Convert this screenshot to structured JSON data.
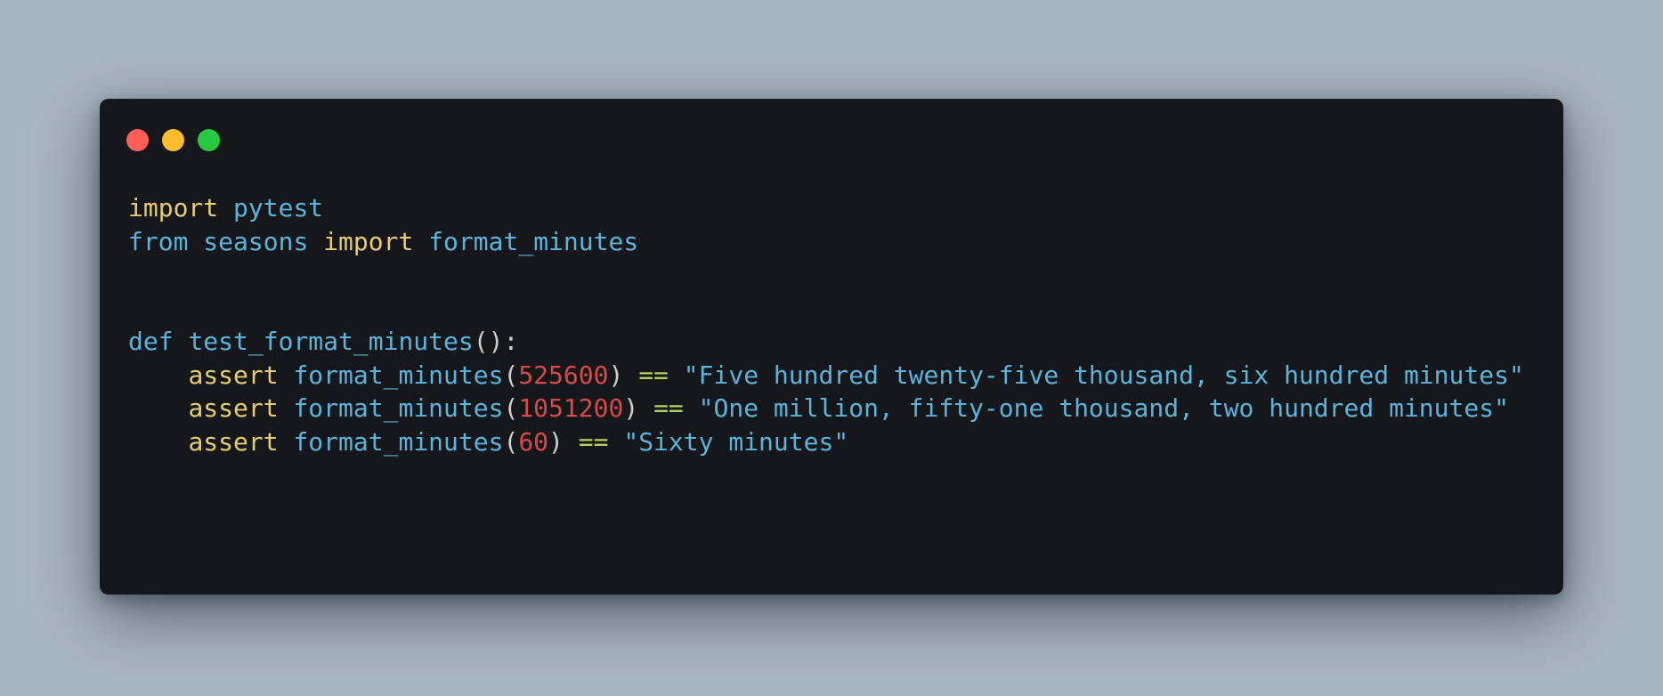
{
  "window": {
    "controls": [
      {
        "name": "close",
        "color": "#ff5f57"
      },
      {
        "name": "minimize",
        "color": "#febc2e"
      },
      {
        "name": "maximize",
        "color": "#28c840"
      }
    ]
  },
  "colors": {
    "background": "#a9b5c1",
    "window": "#16171a",
    "keyword": "#e5cd72",
    "identifier": "#5ab4dc",
    "number": "#d64a4a",
    "operator": "#b3d45c",
    "punctuation": "#cfcfcf"
  },
  "code": {
    "lines": [
      [
        {
          "text": "import",
          "kind": "keyword"
        },
        {
          "text": " ",
          "kind": "space"
        },
        {
          "text": "pytest",
          "kind": "identifier"
        }
      ],
      [
        {
          "text": "from",
          "kind": "identifier"
        },
        {
          "text": " ",
          "kind": "space"
        },
        {
          "text": "seasons",
          "kind": "identifier"
        },
        {
          "text": " ",
          "kind": "space"
        },
        {
          "text": "import",
          "kind": "keyword"
        },
        {
          "text": " ",
          "kind": "space"
        },
        {
          "text": "format_minutes",
          "kind": "identifier"
        }
      ],
      [],
      [],
      [
        {
          "text": "def",
          "kind": "identifier"
        },
        {
          "text": " ",
          "kind": "space"
        },
        {
          "text": "test_format_minutes",
          "kind": "identifier"
        },
        {
          "text": "():",
          "kind": "punctuation"
        }
      ],
      [
        {
          "text": "    ",
          "kind": "space"
        },
        {
          "text": "assert",
          "kind": "keyword"
        },
        {
          "text": " ",
          "kind": "space"
        },
        {
          "text": "format_minutes",
          "kind": "identifier"
        },
        {
          "text": "(",
          "kind": "punctuation"
        },
        {
          "text": "525600",
          "kind": "number"
        },
        {
          "text": ")",
          "kind": "punctuation"
        },
        {
          "text": " ",
          "kind": "space"
        },
        {
          "text": "==",
          "kind": "operator"
        },
        {
          "text": " ",
          "kind": "space"
        },
        {
          "text": "\"Five hundred twenty-five thousand, six hundred minutes\"",
          "kind": "identifier"
        }
      ],
      [
        {
          "text": "    ",
          "kind": "space"
        },
        {
          "text": "assert",
          "kind": "keyword"
        },
        {
          "text": " ",
          "kind": "space"
        },
        {
          "text": "format_minutes",
          "kind": "identifier"
        },
        {
          "text": "(",
          "kind": "punctuation"
        },
        {
          "text": "1051200",
          "kind": "number"
        },
        {
          "text": ")",
          "kind": "punctuation"
        },
        {
          "text": " ",
          "kind": "space"
        },
        {
          "text": "==",
          "kind": "operator"
        },
        {
          "text": " ",
          "kind": "space"
        },
        {
          "text": "\"One million, fifty-one thousand, two hundred minutes\"",
          "kind": "identifier"
        }
      ],
      [
        {
          "text": "    ",
          "kind": "space"
        },
        {
          "text": "assert",
          "kind": "keyword"
        },
        {
          "text": " ",
          "kind": "space"
        },
        {
          "text": "format_minutes",
          "kind": "identifier"
        },
        {
          "text": "(",
          "kind": "punctuation"
        },
        {
          "text": "60",
          "kind": "number"
        },
        {
          "text": ")",
          "kind": "punctuation"
        },
        {
          "text": " ",
          "kind": "space"
        },
        {
          "text": "==",
          "kind": "operator"
        },
        {
          "text": " ",
          "kind": "space"
        },
        {
          "text": "\"Sixty minutes\"",
          "kind": "identifier"
        }
      ]
    ]
  }
}
